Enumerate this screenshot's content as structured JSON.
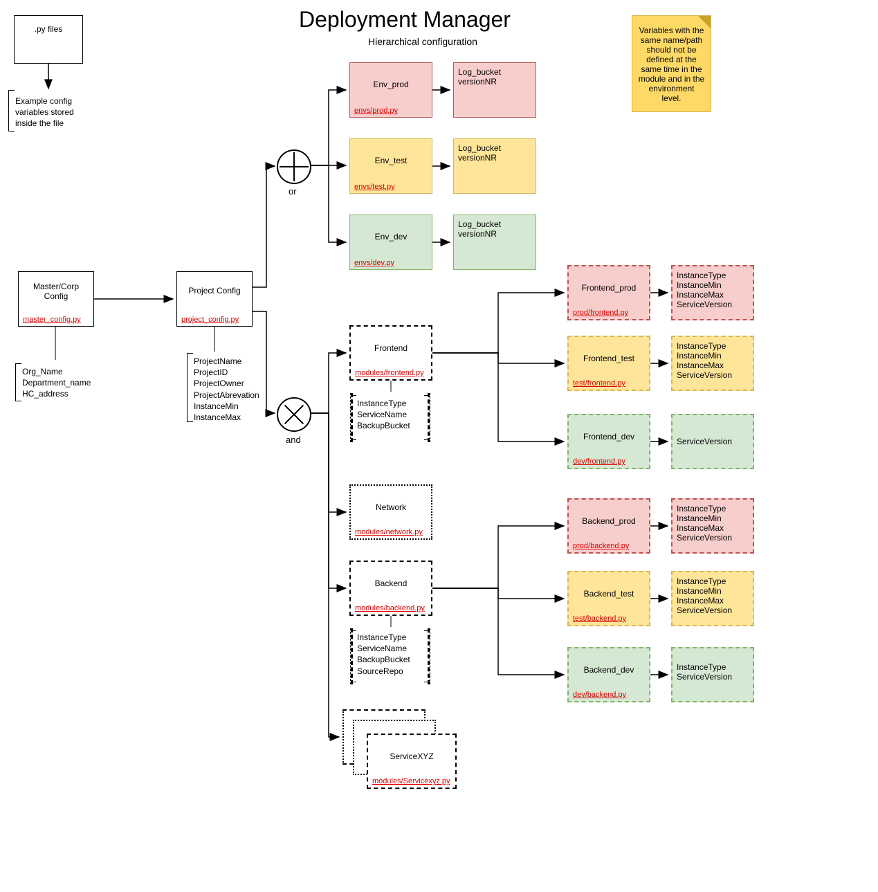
{
  "title": "Deployment Manager",
  "subtitle": "Hierarchical configuration",
  "legend": {
    "box_label": ".py files",
    "desc_l1": "Example config",
    "desc_l2": "variables stored",
    "desc_l3": "inside the file"
  },
  "note": "Variables with the same name/path should not be defined at the same time in the module and in  the environment level.",
  "master": {
    "label": "Master/Corp Config",
    "file": "master_config.py",
    "vars": [
      "Org_Name",
      "Department_name",
      "HC_address"
    ]
  },
  "project": {
    "label": "Project Config",
    "file": "project_config.py",
    "vars": [
      "ProjectName",
      "ProjectID",
      "ProjectOwner",
      "ProjectAbrevation",
      "InstanceMin",
      "InstanceMax"
    ]
  },
  "gates": {
    "or": "or",
    "and": "and"
  },
  "envs": {
    "prod": {
      "label": "Env_prod",
      "file": "envs/prod.py",
      "vars": [
        "Log_bucket",
        "versionNR"
      ]
    },
    "test": {
      "label": "Env_test",
      "file": "envs/test.py",
      "vars": [
        "Log_bucket",
        "versionNR"
      ]
    },
    "dev": {
      "label": "Env_dev",
      "file": "envs/dev.py",
      "vars": [
        "Log_bucket",
        "versionNR"
      ]
    }
  },
  "modules": {
    "frontend": {
      "label": "Frontend",
      "file": "modules/frontend.py",
      "vars": [
        "InstanceType",
        "ServiceName",
        "BackupBucket"
      ]
    },
    "network": {
      "label": "Network",
      "file": "modules/network.py"
    },
    "backend": {
      "label": "Backend",
      "file": "modules/backend.py",
      "vars": [
        "InstanceType",
        "ServiceName",
        "BackupBucket",
        "SourceRepo"
      ]
    },
    "servicexyz": {
      "label": "ServiceXYZ",
      "file": "modules/Servicexyz.py"
    }
  },
  "frontend_env": {
    "prod": {
      "label": "Frontend_prod",
      "file": "prod/frontend.py",
      "vars": [
        "InstanceType",
        "InstanceMin",
        "InstanceMax",
        "ServiceVersion"
      ]
    },
    "test": {
      "label": "Frontend_test",
      "file": "test/frontend.py",
      "vars": [
        "InstanceType",
        "InstanceMin",
        "InstanceMax",
        "ServiceVersion"
      ]
    },
    "dev": {
      "label": "Frontend_dev",
      "file": "dev/frontend.py",
      "vars": [
        "ServiceVersion"
      ]
    }
  },
  "backend_env": {
    "prod": {
      "label": "Backend_prod",
      "file": "prod/backend.py",
      "vars": [
        "InstanceType",
        "InstanceMin",
        "InstanceMax",
        "ServiceVersion"
      ]
    },
    "test": {
      "label": "Backend_test",
      "file": "test/backend.py",
      "vars": [
        "InstanceType",
        "InstanceMin",
        "InstanceMax",
        "ServiceVersion"
      ]
    },
    "dev": {
      "label": "Backend_dev",
      "file": "dev/backend.py",
      "vars": [
        "InstanceType",
        "ServiceVersion"
      ]
    }
  }
}
